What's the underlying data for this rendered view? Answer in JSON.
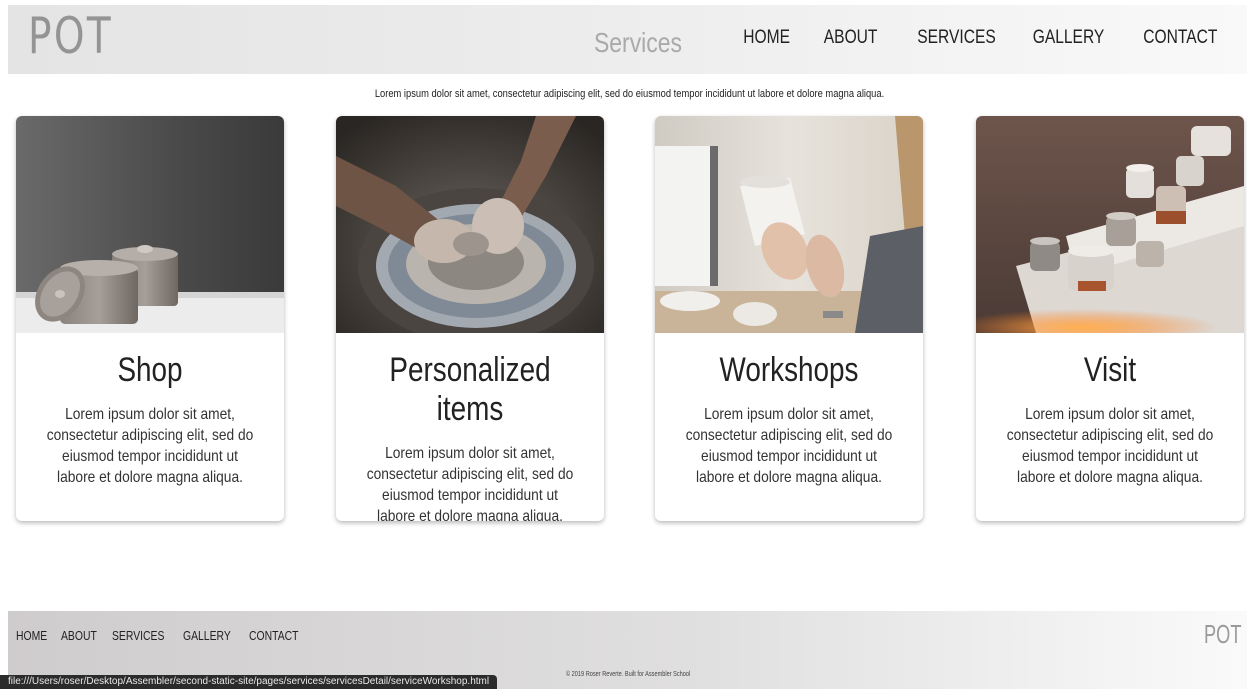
{
  "header": {
    "logo": "POT",
    "page_title": "Services",
    "nav": [
      "HOME",
      "ABOUT",
      "SERVICES",
      "GALLERY",
      "CONTACT"
    ]
  },
  "intro": "Lorem ipsum dolor sit amet, consectetur adipiscing elit, sed do eiusmod tempor incididunt ut labore et dolore magna aliqua.",
  "cards": [
    {
      "title": "Shop",
      "text": "Lorem ipsum dolor sit amet, consectetur adipiscing elit, sed do eiusmod tempor incididunt ut labore et dolore magna aliqua."
    },
    {
      "title": "Personalized items",
      "text": "Lorem ipsum dolor sit amet, consectetur adipiscing elit, sed do eiusmod tempor incididunt ut labore et dolore magna aliqua."
    },
    {
      "title": "Workshops",
      "text": "Lorem ipsum dolor sit amet, consectetur adipiscing elit, sed do eiusmod tempor incididunt ut labore et dolore magna aliqua."
    },
    {
      "title": "Visit",
      "text": "Lorem ipsum dolor sit amet, consectetur adipiscing elit, sed do eiusmod tempor incididunt ut labore et dolore magna aliqua."
    }
  ],
  "footer": {
    "nav": [
      "HOME",
      "ABOUT",
      "SERVICES",
      "GALLERY",
      "CONTACT"
    ],
    "logo": "POT",
    "copyright": "© 2019 Roser Reverte. Built for Assembler School"
  },
  "status_bar": "file:///Users/roser/Desktop/Assembler/second-static-site/pages/services/servicesDetail/serviceWorkshop.html"
}
